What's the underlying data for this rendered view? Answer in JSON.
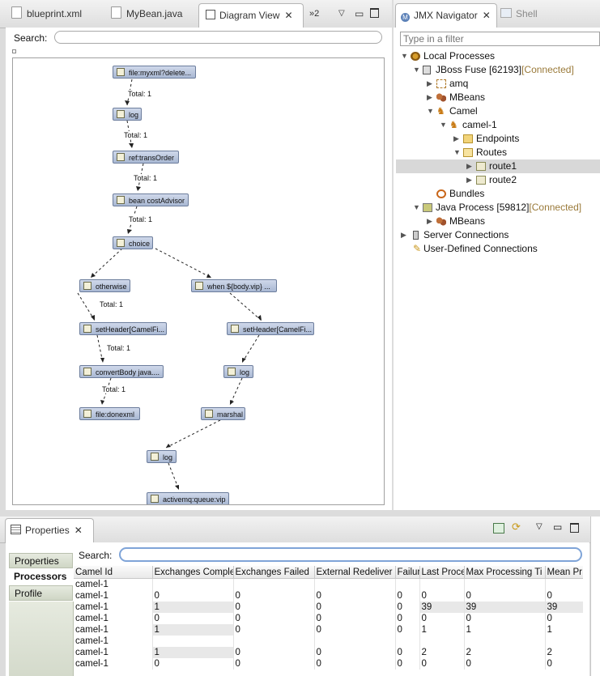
{
  "editor_tabs": [
    {
      "label": "blueprint.xml"
    },
    {
      "label": "MyBean.java"
    },
    {
      "label": "Diagram View"
    },
    {
      "label": "»2"
    }
  ],
  "diagram": {
    "search_label": "Search:",
    "search_value": "",
    "nodes": [
      {
        "label": "file:myxml?delete..."
      },
      {
        "label": "log"
      },
      {
        "label": "ref:transOrder"
      },
      {
        "label": "bean costAdvisor"
      },
      {
        "label": "choice"
      },
      {
        "label": "otherwise"
      },
      {
        "label": "when ${body.vip} ..."
      },
      {
        "label": "setHeader[CamelFi..."
      },
      {
        "label": "setHeader[CamelFi..."
      },
      {
        "label": "convertBody java...."
      },
      {
        "label": "log"
      },
      {
        "label": "file:donexml"
      },
      {
        "label": "marshal"
      },
      {
        "label": "log"
      },
      {
        "label": "activemq:queue:vip"
      }
    ],
    "edge_labels": [
      "Total: 1",
      "Total: 1",
      "Total: 1",
      "Total: 1",
      "Total: 1",
      "Total: 1",
      "Total: 1"
    ]
  },
  "navigator": {
    "tab_label": "JMX Navigator",
    "shell_tab_label": "Shell",
    "filter_placeholder": "Type in a filter",
    "tree": [
      {
        "label": "Local Processes",
        "suffix": ""
      },
      {
        "label": "JBoss Fuse [62193]",
        "suffix": "[Connected]"
      },
      {
        "label": "amq",
        "suffix": ""
      },
      {
        "label": "MBeans",
        "suffix": ""
      },
      {
        "label": "Camel",
        "suffix": ""
      },
      {
        "label": "camel-1",
        "suffix": ""
      },
      {
        "label": "Endpoints",
        "suffix": ""
      },
      {
        "label": "Routes",
        "suffix": ""
      },
      {
        "label": "route1",
        "suffix": ""
      },
      {
        "label": "route2",
        "suffix": ""
      },
      {
        "label": "Bundles",
        "suffix": ""
      },
      {
        "label": "Java Process [59812]",
        "suffix": "[Connected]"
      },
      {
        "label": "MBeans",
        "suffix": ""
      },
      {
        "label": "Server Connections",
        "suffix": ""
      },
      {
        "label": "User-Defined Connections",
        "suffix": ""
      }
    ]
  },
  "properties": {
    "tab_label": "Properties",
    "side_tabs": [
      {
        "label": "Properties"
      },
      {
        "label": "Processors"
      },
      {
        "label": "Profile"
      }
    ],
    "search_label": "Search:",
    "search_value": "",
    "columns": [
      "Camel Id",
      "Exchanges Comple",
      "Exchanges Failed",
      "External Redeliver",
      "Failur",
      "Last Proce",
      "Max Processing Ti",
      "Mean Pr"
    ],
    "rows": [
      [
        "camel-1",
        "",
        "",
        "",
        "",
        "",
        "",
        ""
      ],
      [
        "camel-1",
        "0",
        "0",
        "0",
        "0",
        "0",
        "0",
        "0"
      ],
      [
        "camel-1",
        "1",
        "0",
        "0",
        "0",
        "39",
        "39",
        "39"
      ],
      [
        "camel-1",
        "0",
        "0",
        "0",
        "0",
        "0",
        "0",
        "0"
      ],
      [
        "camel-1",
        "1",
        "0",
        "0",
        "0",
        "1",
        "1",
        "1"
      ],
      [
        "camel-1",
        "",
        "",
        "",
        "",
        "",
        "",
        ""
      ],
      [
        "camel-1",
        "1",
        "0",
        "0",
        "0",
        "2",
        "2",
        "2"
      ],
      [
        "camel-1",
        "0",
        "0",
        "0",
        "0",
        "0",
        "0",
        "0"
      ]
    ]
  },
  "colors": {
    "accent": "#6c8fc4",
    "connected": "#9a7a3a",
    "node_fill": "#b9c6de"
  }
}
